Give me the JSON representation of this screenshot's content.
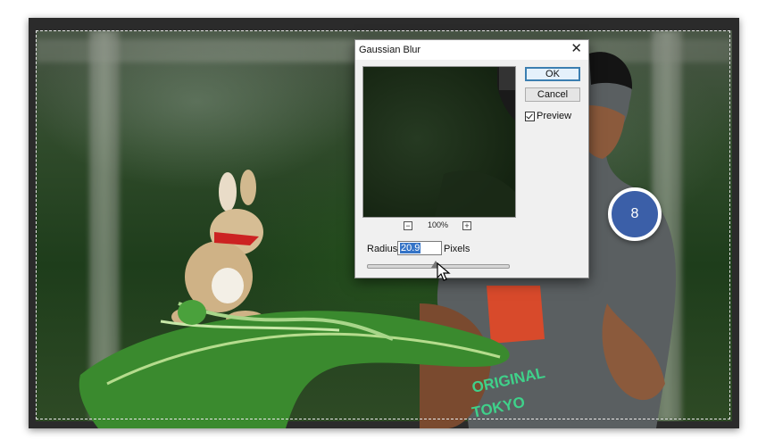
{
  "dialog": {
    "title": "Gaussian Blur",
    "close_glyph": "✕",
    "ok_label": "OK",
    "cancel_label": "Cancel",
    "preview_label": "Preview",
    "preview_checked": true,
    "zoom_out_glyph": "−",
    "zoom_in_glyph": "+",
    "zoom_level": "100%",
    "radius_label": "Radius:",
    "radius_value": "20.9",
    "units_label": "Pixels",
    "slider_fraction": 0.49
  },
  "shirt_text": {
    "line1": "ORIGINAL",
    "line2": "TOKYO"
  },
  "step_badge": {
    "number": "8",
    "color": "#3b5fa8"
  },
  "icons": {
    "close": "close-icon",
    "zoom_out": "zoom-out-icon",
    "zoom_in": "zoom-in-icon",
    "cursor": "mouse-pointer-icon"
  }
}
